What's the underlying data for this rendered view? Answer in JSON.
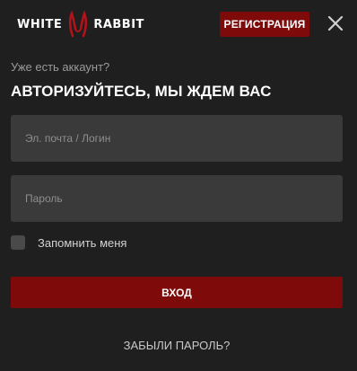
{
  "header": {
    "logo_left": "WHITE",
    "logo_right": "RABBIT",
    "logo_mark": "rabbit-logo-icon",
    "register_label": "РЕГИСТРАЦИЯ",
    "close_icon": "close-icon"
  },
  "form": {
    "subtitle": "Уже есть аккаунт?",
    "title": "АВТОРИЗУЙТЕСЬ, МЫ ЖДЕМ ВАС",
    "login_placeholder": "Эл. почта / Логин",
    "login_value": "",
    "password_placeholder": "Пароль",
    "password_value": "",
    "remember_label": "Запомнить меня",
    "remember_checked": false,
    "submit_label": "ВХОД",
    "forgot_label": "ЗАБЫЛИ ПАРОЛЬ?"
  },
  "colors": {
    "background": "#1f1f1f",
    "accent": "#7e0a0a",
    "field_background": "#3a3a3a"
  }
}
